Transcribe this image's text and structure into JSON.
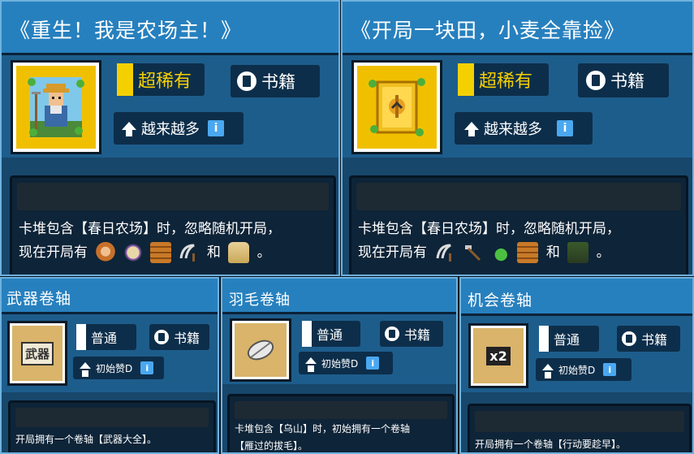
{
  "cards": [
    {
      "title": "《重生！我是农场主！》",
      "rarity": "超稀有",
      "category": "书籍",
      "tag": "越来越多",
      "info": "i",
      "desc_line1": "卡堆包含【春日农场】时，忽略随机开局，",
      "desc_line2_prefix": "现在开局有",
      "desc_and": "和",
      "desc_end": "。",
      "icons_before": [
        "girl-icon",
        "sheep-icon",
        "wood-plank-icon",
        "sickle-icon"
      ],
      "icon_after": "seed-bag-icon"
    },
    {
      "title": "《开局一块田，小麦全靠捡》",
      "rarity": "超稀有",
      "category": "书籍",
      "tag": "越来越多",
      "info": "i",
      "desc_line1": "卡堆包含【春日农场】时，忽略随机开局，",
      "desc_line2_prefix": "现在开局有",
      "desc_and": "和",
      "desc_end": "。",
      "icons_before": [
        "sickle-icon",
        "hoe-icon",
        "watering-can-icon",
        "wood-plank-icon"
      ],
      "icon_after": "soil-sprout-icon"
    },
    {
      "title": "武器卷轴",
      "rarity": "普通",
      "category": "书籍",
      "tag": "初始赞D",
      "info": "i",
      "scroll_label": "武器",
      "desc_line1": "开局拥有一个卷轴【武器大全】。",
      "desc_line2": ""
    },
    {
      "title": "羽毛卷轴",
      "rarity": "普通",
      "category": "书籍",
      "tag": "初始赞D",
      "info": "i",
      "desc_line1": "卡堆包含【乌山】时，初始拥有一个卷轴",
      "desc_line2": "【雁过的拔毛】。"
    },
    {
      "title": "机会卷轴",
      "rarity": "普通",
      "category": "书籍",
      "tag": "初始赞D",
      "info": "i",
      "scroll_label": "x2",
      "desc_line1": "开局拥有一个卷轴【行动要趁早】。",
      "desc_line2": ""
    }
  ],
  "colors": {
    "panel": "#1d5d8c",
    "header": "#2780be",
    "rare_bar": "#f5d000",
    "common_bar": "#ffffff",
    "frame_gold": "#f0c000",
    "frame_scroll": "#d9b46a"
  }
}
